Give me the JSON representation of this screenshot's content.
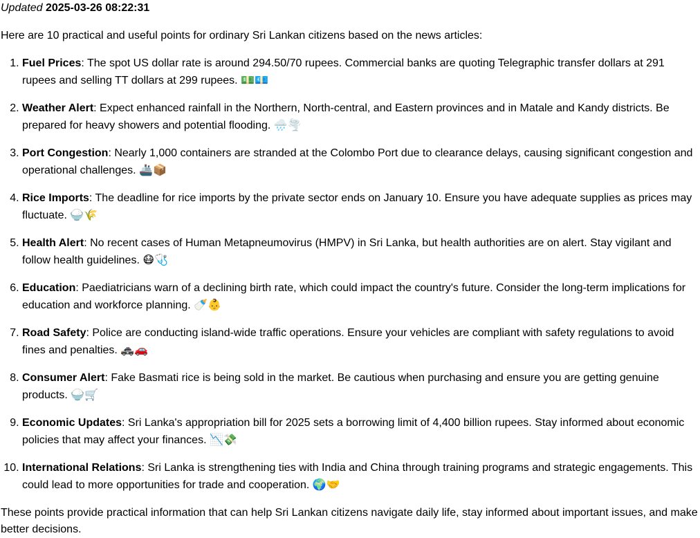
{
  "header": {
    "updated_label": "Updated",
    "timestamp": "2025-03-26 08:22:31"
  },
  "intro": "Here are 10 practical and useful points for ordinary Sri Lankan citizens based on the news articles:",
  "points": [
    {
      "number": "1",
      "title": "Fuel Prices",
      "text": ": The spot US dollar rate is around 294.50/70 rupees. Commercial banks are quoting Telegraphic transfer dollars at 291 rupees and selling TT dollars at 299 rupees. ",
      "emoji": "💵💶"
    },
    {
      "number": "2",
      "title": "Weather Alert",
      "text": ": Expect enhanced rainfall in the Northern, North-central, and Eastern provinces and in Matale and Kandy districts. Be prepared for heavy showers and potential flooding. ",
      "emoji": "🌧️🌪️"
    },
    {
      "number": "3",
      "title": "Port Congestion",
      "text": ": Nearly 1,000 containers are stranded at the Colombo Port due to clearance delays, causing significant congestion and operational challenges. ",
      "emoji": "🚢📦"
    },
    {
      "number": "4",
      "title": "Rice Imports",
      "text": ": The deadline for rice imports by the private sector ends on January 10. Ensure you have adequate supplies as prices may fluctuate. ",
      "emoji": "🍚🌾"
    },
    {
      "number": "5",
      "title": "Health Alert",
      "text": ": No recent cases of Human Metapneumovirus (HMPV) in Sri Lanka, but health authorities are on alert. Stay vigilant and follow health guidelines. ",
      "emoji": "😷🩺"
    },
    {
      "number": "6",
      "title": "Education",
      "text": ": Paediatricians warn of a declining birth rate, which could impact the country's future. Consider the long-term implications for education and workforce planning. ",
      "emoji": "🍼👶"
    },
    {
      "number": "7",
      "title": "Road Safety",
      "text": ": Police are conducting island-wide traffic operations. Ensure your vehicles are compliant with safety regulations to avoid fines and penalties. ",
      "emoji": "🚓🚗"
    },
    {
      "number": "8",
      "title": "Consumer Alert",
      "text": ": Fake Basmati rice is being sold in the market. Be cautious when purchasing and ensure you are getting genuine products. ",
      "emoji": "🍚🛒"
    },
    {
      "number": "9",
      "title": "Economic Updates",
      "text": ": Sri Lanka's appropriation bill for 2025 sets a borrowing limit of 4,400 billion rupees. Stay informed about economic policies that may affect your finances. ",
      "emoji": "📉💸"
    },
    {
      "number": "10",
      "title": "International Relations",
      "text": ": Sri Lanka is strengthening ties with India and China through training programs and strategic engagements. This could lead to more opportunities for trade and cooperation. ",
      "emoji": "🌍🤝"
    }
  ],
  "outro": "These points provide practical information that can help Sri Lankan citizens navigate daily life, stay informed about important issues, and make better decisions."
}
